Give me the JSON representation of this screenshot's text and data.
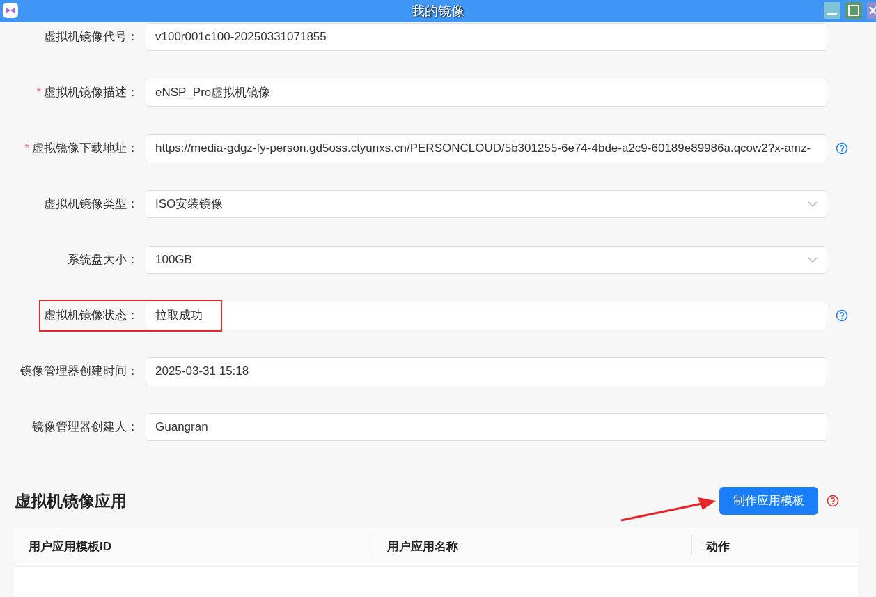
{
  "window": {
    "title": "我的镜像"
  },
  "form": [
    {
      "label": "虚拟机镜像代号：",
      "kind": "text",
      "value": "v100r001c100-20250331071855",
      "help": false,
      "highlighted": false
    },
    {
      "required_mark": "*",
      "label": "虚拟机镜像描述：",
      "kind": "text",
      "value": "eNSP_Pro虚拟机镜像",
      "help": false,
      "highlighted": false
    },
    {
      "required_mark": "*",
      "label": "虚拟镜像下载地址：",
      "kind": "text",
      "value": "https://media-gdgz-fy-person.gd5oss.ctyunxs.cn/PERSONCLOUD/5b301255-6e74-4bde-a2c9-60189e89986a.qcow2?x-amz-",
      "help": true,
      "highlighted": false
    },
    {
      "label": "虚拟机镜像类型：",
      "kind": "select",
      "value": "ISO安装镜像",
      "help": false,
      "highlighted": false
    },
    {
      "label": "系统盘大小：",
      "kind": "select",
      "value": "100GB",
      "help": false,
      "highlighted": false
    },
    {
      "label": "虚拟机镜像状态：",
      "kind": "text",
      "value": "拉取成功",
      "help": true,
      "highlighted": true
    },
    {
      "label": "镜像管理器创建时间：",
      "kind": "text",
      "value": "2025-03-31 15:18",
      "help": false,
      "highlighted": false
    },
    {
      "label": "镜像管理器创建人：",
      "kind": "text",
      "value": "Guangran",
      "help": false,
      "highlighted": false
    }
  ],
  "section": {
    "title": "虚拟机镜像应用",
    "button": "制作应用模板"
  },
  "table": {
    "columns": [
      "用户应用模板ID",
      "用户应用名称",
      "动作"
    ]
  }
}
